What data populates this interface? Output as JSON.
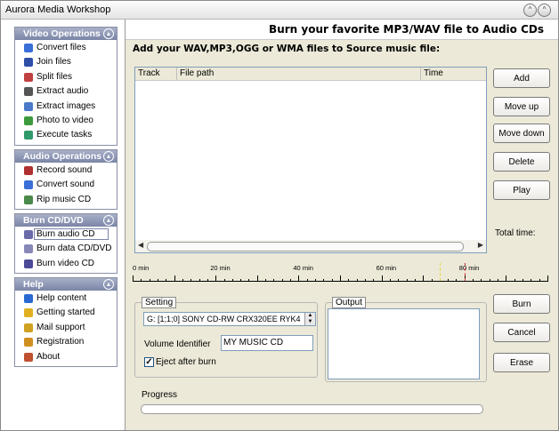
{
  "window": {
    "title": "Aurora Media Workshop",
    "restore_glyph": "^",
    "close_glyph": "^"
  },
  "sidebar": {
    "panels": [
      {
        "title": "Video Operations",
        "items": [
          {
            "label": "Convert files",
            "icon": "convert-files-icon",
            "color": "#3a6fd8"
          },
          {
            "label": "Join files",
            "icon": "join-files-icon",
            "color": "#2d4fa8"
          },
          {
            "label": "Split files",
            "icon": "split-files-icon",
            "color": "#c04040"
          },
          {
            "label": "Extract audio",
            "icon": "extract-audio-icon",
            "color": "#555555"
          },
          {
            "label": "Extract images",
            "icon": "extract-images-icon",
            "color": "#4a7ac8"
          },
          {
            "label": "Photo to video",
            "icon": "photo-to-video-icon",
            "color": "#3c9a3c"
          },
          {
            "label": "Execute tasks",
            "icon": "execute-tasks-icon",
            "color": "#2f9a6a"
          }
        ]
      },
      {
        "title": "Audio Operations",
        "items": [
          {
            "label": "Record sound",
            "icon": "record-sound-icon",
            "color": "#b03030"
          },
          {
            "label": "Convert sound",
            "icon": "convert-sound-icon",
            "color": "#3a6fd8"
          },
          {
            "label": "Rip music CD",
            "icon": "rip-cd-icon",
            "color": "#4a8a4a"
          }
        ]
      },
      {
        "title": "Burn CD/DVD",
        "items": [
          {
            "label": "Burn audio CD",
            "icon": "burn-audio-cd-icon",
            "color": "#6a6aa8",
            "selected": true
          },
          {
            "label": "Burn data CD/DVD",
            "icon": "burn-data-cd-icon",
            "color": "#8888b8"
          },
          {
            "label": "Burn video CD",
            "icon": "burn-video-cd-icon",
            "color": "#4a4a98"
          }
        ]
      },
      {
        "title": "Help",
        "items": [
          {
            "label": "Help content",
            "icon": "help-icon",
            "color": "#2a6ad0"
          },
          {
            "label": "Getting started",
            "icon": "getting-started-icon",
            "color": "#e0b020"
          },
          {
            "label": "Mail support",
            "icon": "mail-icon",
            "color": "#d0a020"
          },
          {
            "label": "Registration",
            "icon": "registration-icon",
            "color": "#d09020"
          },
          {
            "label": "About",
            "icon": "home-icon",
            "color": "#c05030"
          }
        ]
      }
    ],
    "collapse_glyph": "▲"
  },
  "main": {
    "banner": "Burn your favorite MP3/WAV file to Audio CDs",
    "instruction": "Add your WAV,MP3,OGG or WMA files to Source music file:",
    "columns": [
      "Track",
      "File path",
      "Time"
    ],
    "buttons": {
      "add": "Add",
      "move_up": "Move up",
      "move_down": "Move down",
      "delete": "Delete",
      "play": "Play",
      "burn": "Burn",
      "cancel": "Cancel",
      "erase": "Erase"
    },
    "total_time_label": "Total time:",
    "ruler": {
      "labels": [
        "0 min",
        "20 min",
        "40 min",
        "60 min",
        "80 min"
      ],
      "minutes": [
        0,
        20,
        40,
        60,
        80
      ],
      "max_minutes": 100,
      "marker_yellow": 74,
      "marker_red": 80
    },
    "setting": {
      "legend": "Setting",
      "drive": "G: [1;1;0] SONY    CD-RW  CRX320EE  RYK4",
      "volume_label": "Volume Identifier",
      "volume_value": "MY MUSIC CD",
      "eject_label": "Eject after burn",
      "eject_checked": true
    },
    "output_legend": "Output",
    "progress_label": "Progress",
    "progress": 0
  }
}
